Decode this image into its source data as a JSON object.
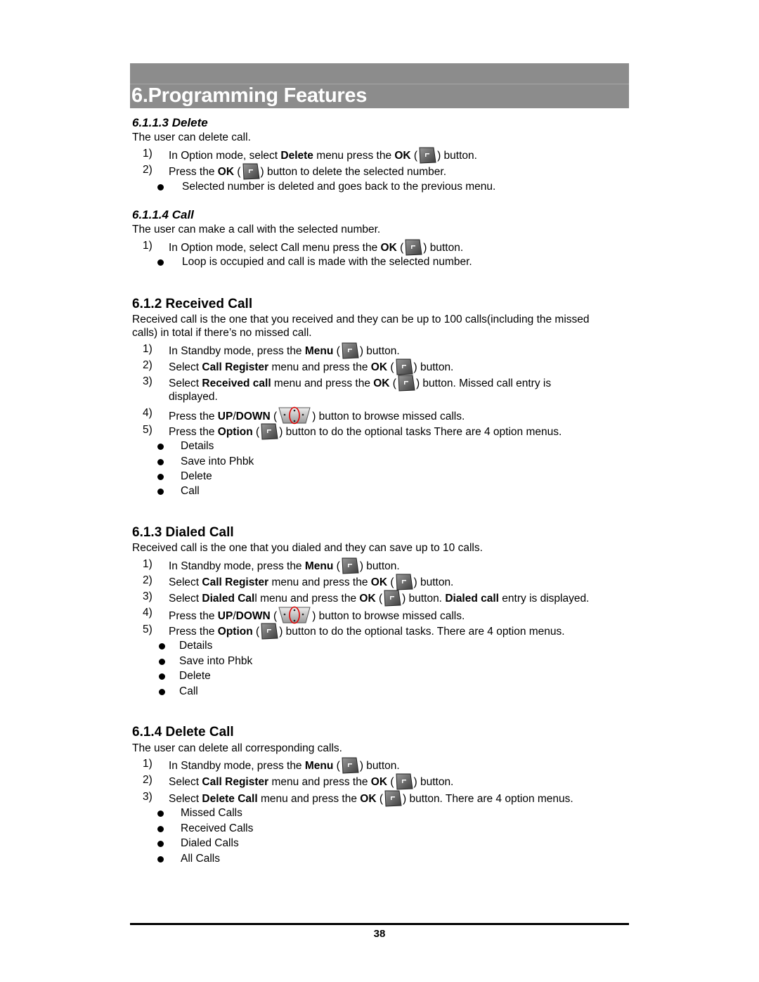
{
  "chapter_title": "6.Programming Features",
  "sections": {
    "delete": {
      "heading": "6.1.1.3 Delete",
      "intro": "The user can delete call.",
      "steps": [
        {
          "n": "1)",
          "a": "In Option mode, select ",
          "b": "Delete",
          "c": " menu press the ",
          "d": "OK",
          "e": " (",
          "f": ") button."
        },
        {
          "n": "2)",
          "a": "Press the ",
          "b": "OK",
          "c": " (",
          "d": ") button to delete the selected number."
        }
      ],
      "bullets": [
        "Selected number is deleted and goes back to the previous menu."
      ]
    },
    "call": {
      "heading": "6.1.1.4 Call",
      "intro": "The user can make a call with the selected number.",
      "steps": [
        {
          "n": "1)",
          "a": "In Option mode, select Call menu press the ",
          "b": "OK",
          "c": " (",
          "d": ") button."
        }
      ],
      "bullets": [
        "Loop is occupied and call is made with the selected number."
      ]
    },
    "received": {
      "heading": "6.1.2 Received Call",
      "intro_1": "Received call is the one that you received and they can be up to 100 calls(including the missed",
      "intro_2": "calls) in total if there’s no missed call.",
      "steps": [
        {
          "n": "1)",
          "a": "In Standby mode, press the ",
          "b": "Menu",
          "c": " (",
          "d": ") button."
        },
        {
          "n": "2)",
          "a": "Select ",
          "b": "Call Register",
          "c": " menu and press the ",
          "d": "OK",
          "e": " (",
          "f": ") button."
        },
        {
          "n": "3)",
          "a": "Select ",
          "b": "Received call",
          "c": " menu and press the ",
          "d": "OK",
          "e": " (",
          "f": ") button. Missed call entry is",
          "g": "displayed."
        },
        {
          "n": "4)",
          "a": "Press the ",
          "b": "UP",
          "c": "/",
          "d": "DOWN",
          "e": " (",
          "f": ") button to browse missed calls."
        },
        {
          "n": "5)",
          "a": "Press the ",
          "b": "Option",
          "c": " (",
          "d": ") button to do the optional tasks There are 4 option menus."
        }
      ],
      "bullets": [
        "Details",
        "Save into Phbk",
        "Delete",
        "Call"
      ]
    },
    "dialed": {
      "heading": "6.1.3 Dialed Call",
      "intro": "Received call is the one that you dialed and they can save up to 10 calls.",
      "steps": [
        {
          "n": "1)",
          "a": "In Standby mode, press the ",
          "b": "Menu",
          "c": " (",
          "d": ") button."
        },
        {
          "n": "2)",
          "a": "Select ",
          "b": "Call Register",
          "c": " menu and press the ",
          "d": "OK",
          "e": " (",
          "f": ") button."
        },
        {
          "n": "3)",
          "a": "Select ",
          "b": "Dialed Cal",
          "c": "l menu and press the ",
          "d": "OK",
          "e": " (",
          "f": ") button. ",
          "g": "Dialed call",
          "h": " entry is displayed."
        },
        {
          "n": "4)",
          "a": "Press the ",
          "b": "UP",
          "c": "/",
          "d": "DOWN",
          "e": " (",
          "f": ") button to browse missed calls."
        },
        {
          "n": "5)",
          "a": "Press the ",
          "b": "Option",
          "c": " (",
          "d": ") button to do the optional tasks. There are 4 option menus."
        }
      ],
      "bullets": [
        "Details",
        "Save into Phbk",
        "Delete",
        "Call"
      ]
    },
    "delete_call": {
      "heading": "6.1.4 Delete Call",
      "intro": "The user can delete all corresponding calls.",
      "steps": [
        {
          "n": "1)",
          "a": "In Standby mode, press the ",
          "b": "Menu",
          "c": " (",
          "d": ") button."
        },
        {
          "n": "2)",
          "a": "Select ",
          "b": "Call Register",
          "c": " menu and press the ",
          "d": "OK",
          "e": " (",
          "f": ") button."
        },
        {
          "n": "3)",
          "a": "Select ",
          "b": "Delete Call",
          "c": " menu and press the ",
          "d": "OK",
          "e": " (",
          "f": ") button. There are 4 option menus."
        }
      ],
      "bullets": [
        "Missed Calls",
        "Received Calls",
        "Dialed Calls",
        "All Calls"
      ]
    }
  },
  "icons": {
    "soft_key": "soft-key-icon",
    "nav_key": "nav-key-icon"
  },
  "colors": {
    "banner": "#8c8c8c",
    "nav_highlight": "#e00000"
  },
  "page_number": "38"
}
